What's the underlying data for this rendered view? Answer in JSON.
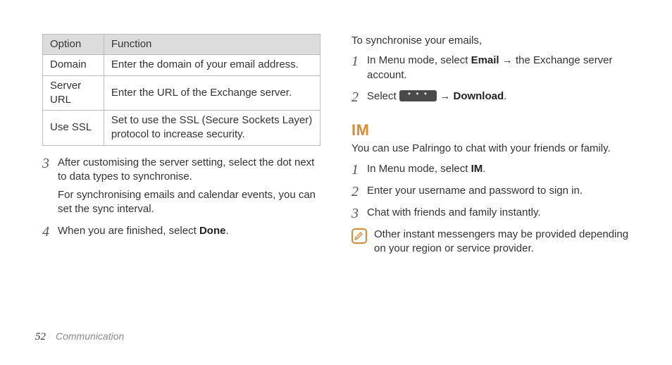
{
  "table": {
    "headers": {
      "option": "Option",
      "function": "Function"
    },
    "rows": [
      {
        "option": "Domain",
        "function": "Enter the domain of your email address."
      },
      {
        "option": "Server URL",
        "function": "Enter the URL of the Exchange server."
      },
      {
        "option": "Use SSL",
        "function": "Set to use the SSL (Secure Sockets Layer) protocol to increase security."
      }
    ]
  },
  "left_steps": {
    "s3": {
      "num": "3",
      "p1": "After customising the server setting, select the dot next to data types to synchronise.",
      "p2": "For synchronising emails and calendar events, you can set the sync interval."
    },
    "s4": {
      "num": "4",
      "p1_a": "When you are finished, select ",
      "p1_b": "Done",
      "p1_c": "."
    }
  },
  "right": {
    "intro": "To synchronise your emails,",
    "s1": {
      "num": "1",
      "a": "In Menu mode, select ",
      "b": "Email",
      "c": " → the Exchange server account."
    },
    "s2": {
      "num": "2",
      "a": "Select ",
      "arrow": " → ",
      "b": "Download",
      "c": "."
    },
    "im_heading": "IM",
    "im_intro": "You can use Palringo to chat with your friends or family.",
    "im_s1": {
      "num": "1",
      "a": "In Menu mode, select ",
      "b": "IM",
      "c": "."
    },
    "im_s2": {
      "num": "2",
      "a": "Enter your username and password to sign in."
    },
    "im_s3": {
      "num": "3",
      "a": "Chat with friends and family instantly."
    },
    "note": "Other instant messengers may be provided depending on your region or service provider."
  },
  "footer": {
    "page": "52",
    "section": "Communication"
  },
  "glyphs": {
    "ellipsis": "• • •"
  }
}
